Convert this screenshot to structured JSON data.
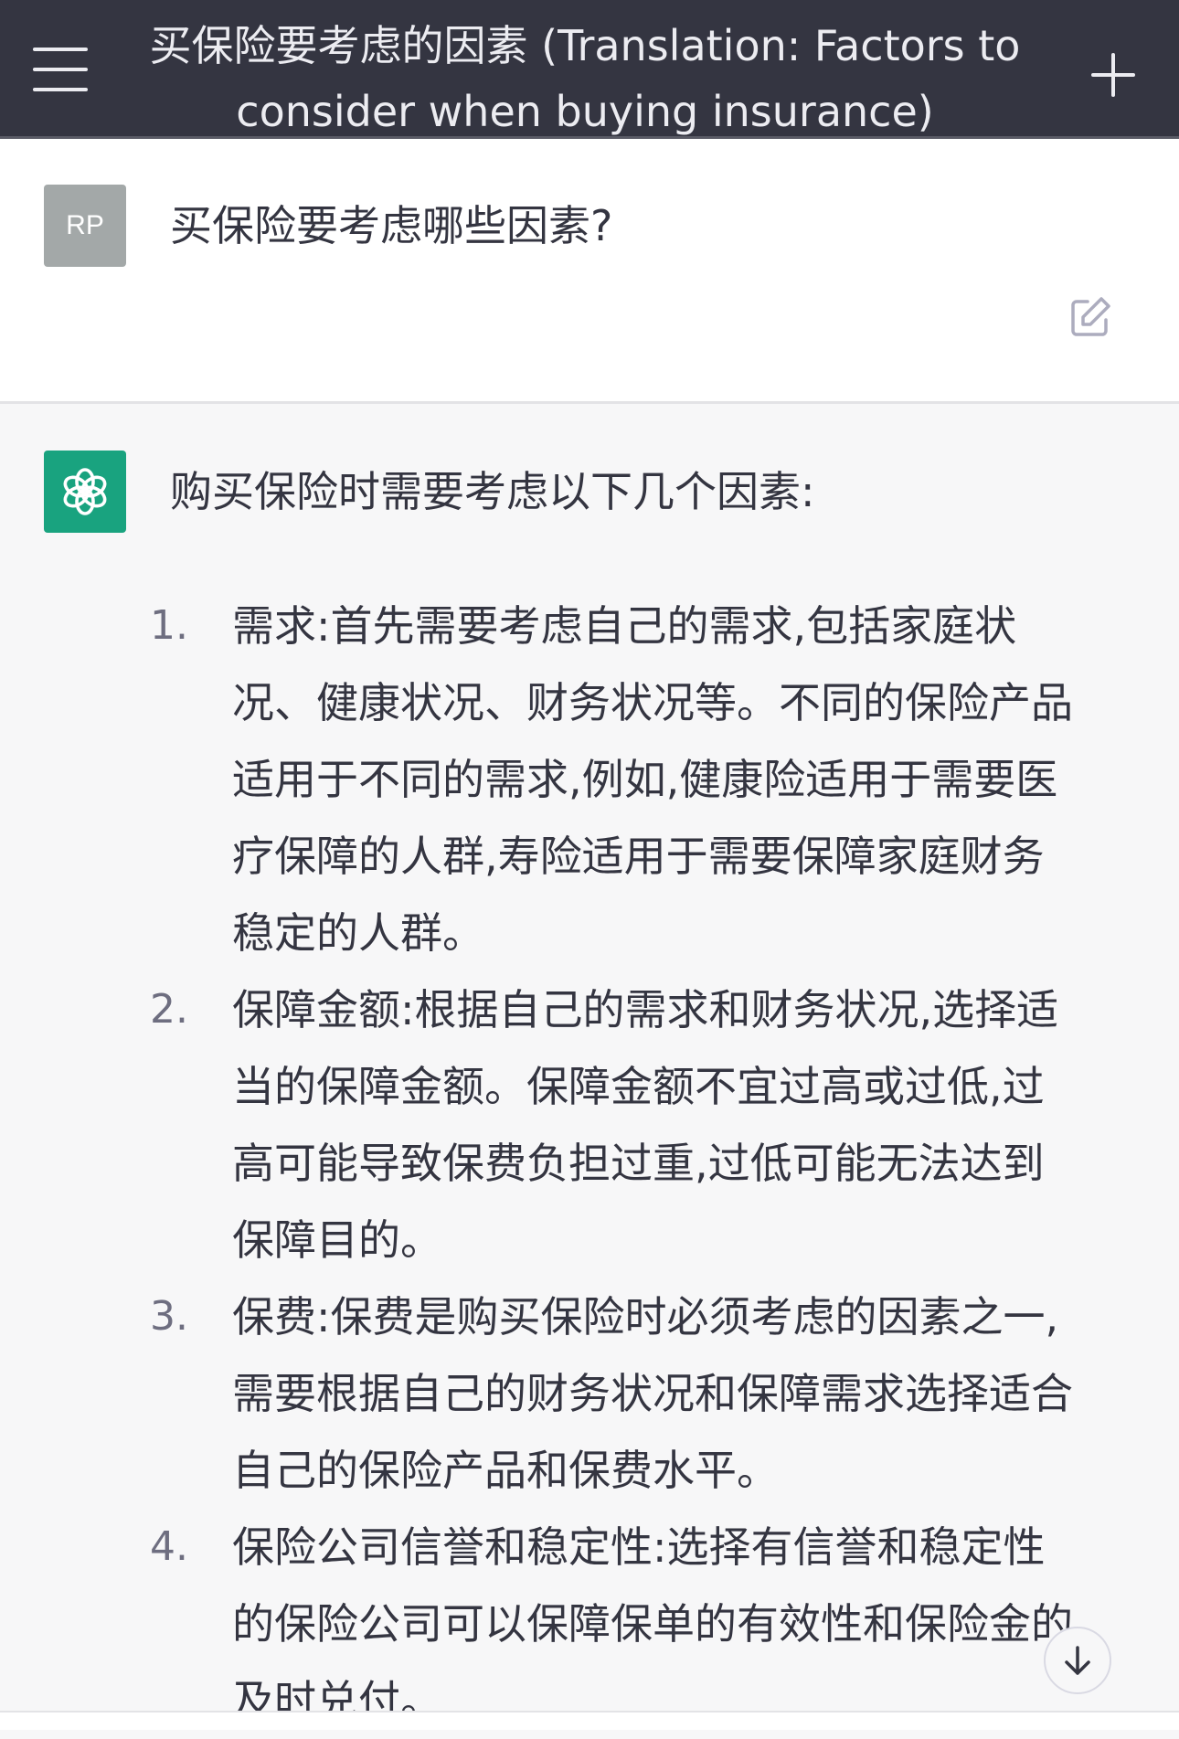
{
  "header": {
    "title": "买保险要考虑的因素 (Translation: Factors to consider when buying insurance)",
    "menu_icon": "hamburger-menu-icon",
    "new_chat_icon": "plus-icon"
  },
  "user_message": {
    "avatar_initials": "RP",
    "text": "买保险要考虑哪些因素?",
    "edit_icon": "edit-icon"
  },
  "assistant_message": {
    "avatar_icon": "openai-logo-icon",
    "intro": "购买保险时需要考虑以下几个因素:",
    "items": [
      {
        "number": "1.",
        "text": "需求:首先需要考虑自己的需求,包括家庭状况、健康状况、财务状况等。不同的保险产品适用于不同的需求,例如,健康险适用于需要医疗保障的人群,寿险适用于需要保障家庭财务稳定的人群。"
      },
      {
        "number": "2.",
        "text": "保障金额:根据自己的需求和财务状况,选择适当的保障金额。保障金额不宜过高或过低,过高可能导致保费负担过重,过低可能无法达到保障目的。"
      },
      {
        "number": "3.",
        "text": "保费:保费是购买保险时必须考虑的因素之一,需要根据自己的财务状况和保障需求选择适合自己的保险产品和保费水平。"
      },
      {
        "number": "4.",
        "text": "保险公司信誉和稳定性:选择有信誉和稳定性的保险公司可以保障保单的有效性和保险金的及时兑付。"
      }
    ]
  },
  "scroll_button_icon": "arrow-down-icon",
  "colors": {
    "header_bg": "#343541",
    "user_bg": "#ffffff",
    "assistant_bg": "#f7f7f8",
    "assistant_avatar": "#19a37f",
    "user_avatar": "#a3a8a8"
  }
}
